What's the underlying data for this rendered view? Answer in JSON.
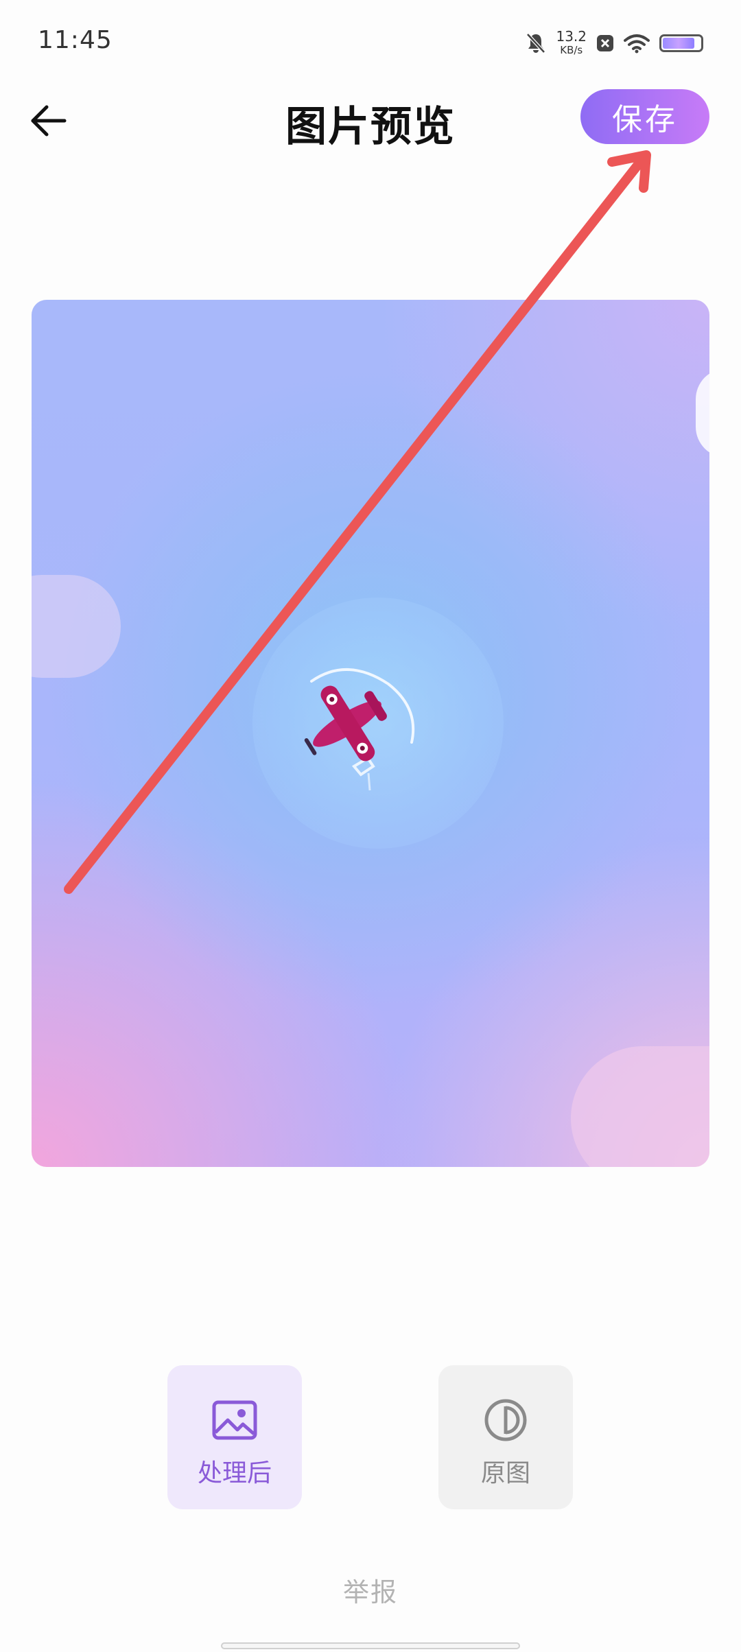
{
  "status_bar": {
    "time": "11:45",
    "net_speed_value": "13.2",
    "net_speed_unit": "KB/s",
    "icons": [
      "mute-bell-icon",
      "close-box-icon",
      "wifi-icon",
      "battery-icon"
    ]
  },
  "header": {
    "title": "图片预览",
    "save_label": "保存",
    "back_icon": "arrow-left-icon"
  },
  "preview": {
    "content_icon": "airplane-icon"
  },
  "view_options": [
    {
      "label": "处理后",
      "icon": "image-icon",
      "selected": true
    },
    {
      "label": "原图",
      "icon": "contrast-circle-icon",
      "selected": false
    }
  ],
  "footer": {
    "report_label": "举报"
  },
  "colors": {
    "accent_start": "#8f6cf4",
    "accent_end": "#c77bf7",
    "selected_option_bg": "#efe8fc",
    "annotation_arrow": "#ec5656"
  }
}
